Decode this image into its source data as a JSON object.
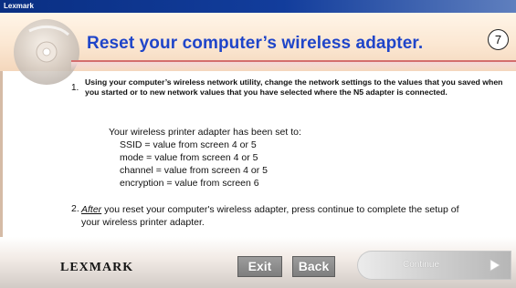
{
  "window": {
    "title": "Lexmark"
  },
  "header": {
    "title": "Reset your computer’s wireless adapter.",
    "step_number": "7"
  },
  "instructions": {
    "step1_number": "1.",
    "step1_text": "Using your computer’s wireless network utility, change the network settings to the values that you saved when you started  or to new network values that you have selected where the N5 adapter is connected.",
    "adapter_intro": "Your wireless printer adapter has been set to:",
    "settings": [
      "SSID = value from screen 4 or 5",
      "mode = value from screen 4 or 5",
      "channel = value from screen 4 or 5",
      "encryption = value from screen 6"
    ],
    "step2_number": "2.",
    "step2_after": "After",
    "step2_text": " you reset your computer's wireless adapter, press continue to complete the setup of your wireless printer adapter."
  },
  "footer": {
    "logo_text": "LEXMARK",
    "exit_label": "Exit",
    "back_label": "Back",
    "continue_label": "Continue"
  }
}
